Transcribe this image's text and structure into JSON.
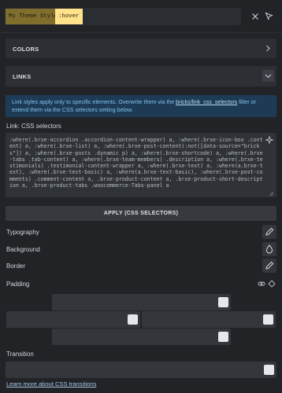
{
  "header": {
    "theme_style_chip": "My Theme Style",
    "state_chip": ":hover"
  },
  "sections": {
    "colors_label": "COLORS",
    "links_label": "LINKS"
  },
  "notice": {
    "text_before": "Link styles apply only to specific elements. Overwrite them via the ",
    "link_text": "bricks/link_css_selectors",
    "text_after": " filter or extend them via the CSS selectors setting below."
  },
  "css_selectors": {
    "label": "Link: CSS selectors",
    "value": ":where(.brxe-accordion .accordion-content-wrapper) a, :where(.brxe-icon-box .content) a, :where(.brxe-list) a, :where(.brxe-post-content):not([data-source=\"bricks\"]) a, :where(.brxe-posts .dynamic p) a, :where(.brxe-shortcode) a, :where(.brxe-tabs .tab-content) a, :where(.brxe-team-members) .description a, :where(.brxe-testimonials) .testimonial-content-wrapper a, :where(.brxe-text) a, :where(a.brxe-text), :where(.brxe-text-basic) a, :where(a.brxe-text-basic), :where(.brxe-post-comments) .comment-content a, .brxe-product-content a, .brxe-product-short-description a, .brxe-product-tabs .woocommerce-Tabs-panel a",
    "apply_button": "APPLY (CSS SELECTORS)"
  },
  "controls": {
    "typography_label": "Typography",
    "background_label": "Background",
    "border_label": "Border",
    "padding_label": "Padding",
    "transition_label": "Transition"
  },
  "footer": {
    "learn_link": "Learn more about CSS transitions"
  },
  "colors": {
    "chip_primary": "#806f2c",
    "chip_hover": "#ffe28a",
    "notice_bg": "#1e3b56",
    "notice_text": "#7fc0ec"
  },
  "icons": [
    "close-icon",
    "cursor-icon",
    "chevron-right-icon",
    "chevron-down-icon",
    "sparkle-icon",
    "pencil-icon",
    "droplet-icon",
    "link-icon",
    "diamond-icon",
    "unit-badge-icon"
  ]
}
